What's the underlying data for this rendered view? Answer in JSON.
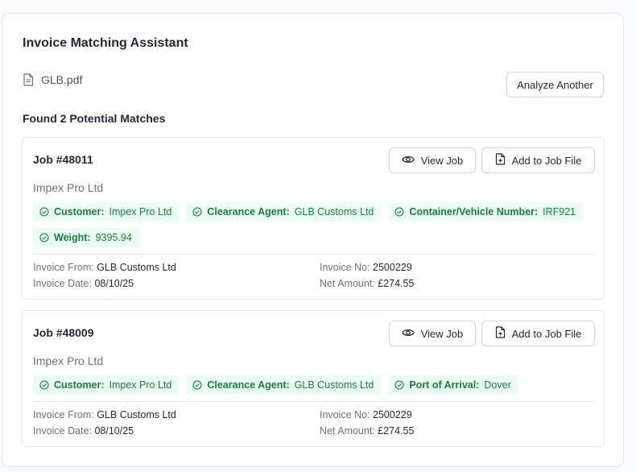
{
  "header": {
    "title": "Invoice Matching Assistant"
  },
  "file": {
    "name": "GLB.pdf",
    "icon": "document-icon"
  },
  "actions": {
    "analyze_another": "Analyze Another"
  },
  "results": {
    "found_text": "Found 2 Potential Matches"
  },
  "colors": {
    "tag_bg": "#ecfdf3",
    "tag_text": "#15803d",
    "border": "#e5e7eb"
  },
  "matches": [
    {
      "job": "Job #48011",
      "view_label": "View Job",
      "add_label": "Add to Job File",
      "company": "Impex Pro Ltd",
      "tags": [
        {
          "label": "Customer:",
          "value": "Impex Pro Ltd"
        },
        {
          "label": "Clearance Agent:",
          "value": "GLB Customs Ltd"
        },
        {
          "label": "Container/Vehicle Number:",
          "value": "IRF921"
        },
        {
          "label": "Weight:",
          "value": "9395.94"
        }
      ],
      "invoice_from_label": "Invoice From:",
      "invoice_from": "GLB Customs Ltd",
      "invoice_no_label": "Invoice No:",
      "invoice_no": "2500229",
      "invoice_date_label": "Invoice Date:",
      "invoice_date": "08/10/25",
      "net_amount_label": "Net Amount:",
      "net_amount": "£274.55"
    },
    {
      "job": "Job #48009",
      "view_label": "View Job",
      "add_label": "Add to Job File",
      "company": "Impex Pro Ltd",
      "tags": [
        {
          "label": "Customer:",
          "value": "Impex Pro Ltd"
        },
        {
          "label": "Clearance Agent:",
          "value": "GLB Customs Ltd"
        },
        {
          "label": "Port of Arrival:",
          "value": "Dover"
        }
      ],
      "invoice_from_label": "Invoice From:",
      "invoice_from": "GLB Customs Ltd",
      "invoice_no_label": "Invoice No:",
      "invoice_no": "2500229",
      "invoice_date_label": "Invoice Date:",
      "invoice_date": "08/10/25",
      "net_amount_label": "Net Amount:",
      "net_amount": "£274.55"
    }
  ]
}
